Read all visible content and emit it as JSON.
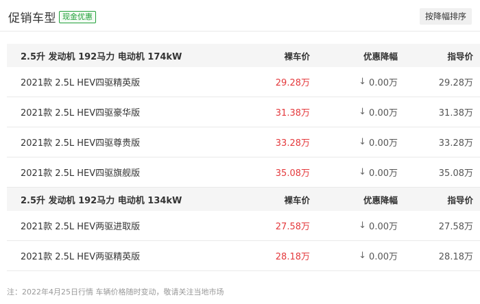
{
  "header": {
    "title": "促销车型",
    "tag": "现金优惠",
    "sort_button": "按降幅排序"
  },
  "groups": [
    {
      "engine": "2.5升 发动机 192马力 电动机 174kW",
      "col_price": "裸车价",
      "col_discount": "优惠降幅",
      "col_guide": "指导价",
      "cars": [
        {
          "name": "2021款 2.5L HEV四驱精英版",
          "price": "29.28万",
          "discount": "0.00万",
          "guide": "29.28万"
        },
        {
          "name": "2021款 2.5L HEV四驱豪华版",
          "price": "31.38万",
          "discount": "0.00万",
          "guide": "31.38万"
        },
        {
          "name": "2021款 2.5L HEV四驱尊贵版",
          "price": "33.28万",
          "discount": "0.00万",
          "guide": "33.28万"
        },
        {
          "name": "2021款 2.5L HEV四驱旗舰版",
          "price": "35.08万",
          "discount": "0.00万",
          "guide": "35.08万"
        }
      ]
    },
    {
      "engine": "2.5升 发动机 192马力 电动机 134kW",
      "col_price": "裸车价",
      "col_discount": "优惠降幅",
      "col_guide": "指导价",
      "cars": [
        {
          "name": "2021款 2.5L HEV两驱进取版",
          "price": "27.58万",
          "discount": "0.00万",
          "guide": "27.58万"
        },
        {
          "name": "2021款 2.5L HEV两驱精英版",
          "price": "28.18万",
          "discount": "0.00万",
          "guide": "28.18万"
        }
      ]
    }
  ],
  "footer": "注：2022年4月25日行情 车辆价格随时变动，敬请关注当地市场",
  "colors": {
    "price": "#e4393c",
    "tag": "#22a03a",
    "group_bg": "#f5f5f5"
  },
  "icons": {
    "discount_arrow": "down-arrow-icon"
  }
}
